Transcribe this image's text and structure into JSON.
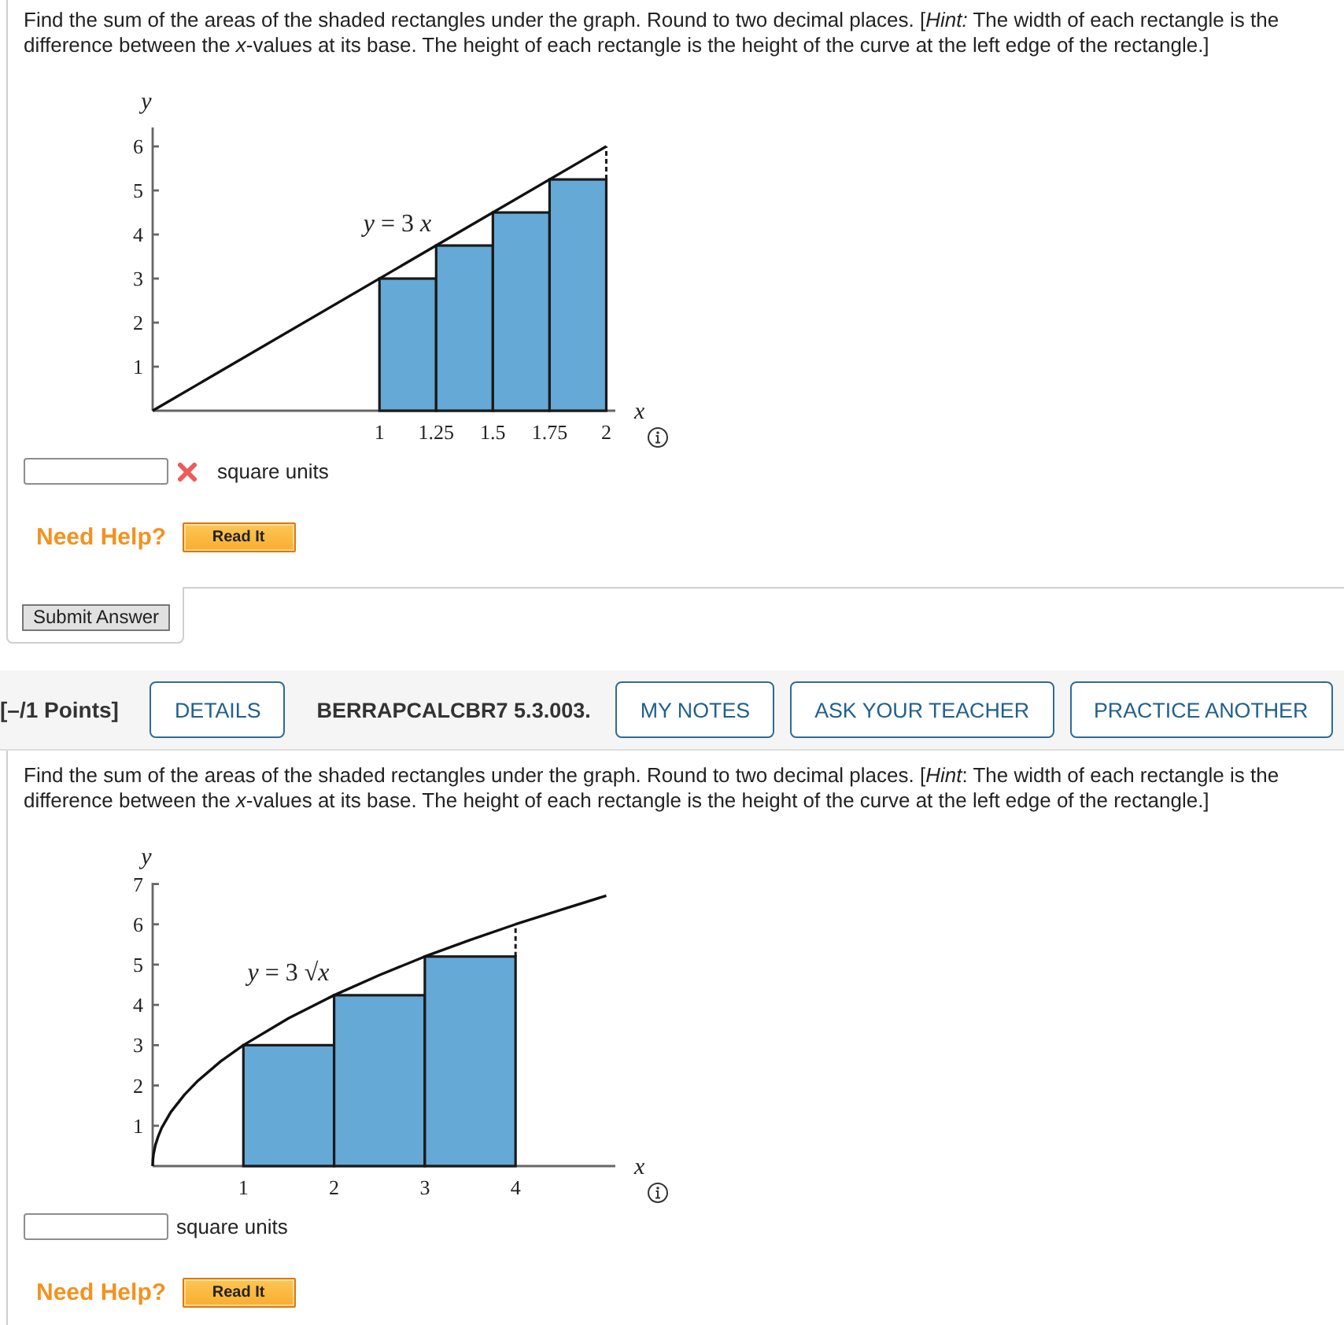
{
  "questions": [
    {
      "text": "Find the sum of the areas of the shaded rectangles under the graph. Round to two decimal places. [*Hint:* The width of each rectangle is the difference between the *x*-values at its base. The height of each rectangle is the height of the curve at the left edge of the rectangle.]",
      "figure": {
        "chart_data": {
          "type": "bar",
          "xlabel": "x",
          "ylabel": "y",
          "xlim": [
            0,
            2.04
          ],
          "ylim": [
            0,
            6.43
          ],
          "xticks": [
            1,
            1.25,
            1.5,
            1.75,
            2
          ],
          "yticks": [
            1,
            2,
            3,
            4,
            5,
            6
          ],
          "series": [
            {
              "color": "#65a9d6",
              "x": [
                1.125,
                1.375,
                1.625,
                1.875
              ],
              "values": [
                3,
                3.75,
                4.5,
                5.25
              ]
            },
            {
              "type": "line",
              "color": "#111111",
              "x": [
                0,
                1.25,
                2
              ],
              "values": [
                0,
                3.75,
                6
              ]
            }
          ],
          "annotations": [
            {
              "text": "*y* = 3 *x*",
              "x": 1.25,
              "y": 3.75
            }
          ]
        }
      },
      "answer": {
        "marked_incorrect": true,
        "unit": "square units"
      },
      "help": {
        "label": "Need Help?",
        "buttons": [
          "Read It"
        ]
      },
      "submit_button": "Submit Answer"
    },
    {
      "header": {
        "points": "[–/1 Points]",
        "items": [
          {
            "kind": "button",
            "text": "DETAILS"
          },
          {
            "kind": "code",
            "text": "BERRAPCALCBR7 5.3.003."
          },
          {
            "kind": "button",
            "text": "MY NOTES"
          },
          {
            "kind": "button",
            "text": "ASK YOUR TEACHER"
          },
          {
            "kind": "button",
            "text": "PRACTICE ANOTHER"
          }
        ]
      },
      "text": "Find the sum of the areas of the shaded rectangles under the graph. Round to two decimal places. [*Hint*: The width of each rectangle is the difference between the *x*-values at its base. The height of each rectangle is the height of the curve at the left edge of the rectangle.]",
      "figure": {
        "chart_data": {
          "type": "bar",
          "xlabel": "x",
          "ylabel": "y",
          "xlim": [
            0,
            5.1
          ],
          "ylim": [
            0,
            7.03
          ],
          "xticks": [
            1,
            2,
            3,
            4
          ],
          "yticks": [
            1,
            2,
            3,
            4,
            5,
            6,
            7
          ],
          "series": [
            {
              "color": "#65a9d6",
              "x": [
                1.5,
                2.5,
                3.5
              ],
              "values": [
                3,
                4.24,
                5.2
              ]
            },
            {
              "type": "line",
              "color": "#111111",
              "x": [
                0,
                0.003,
                0.01,
                0.03,
                0.06,
                0.1,
                0.2,
                0.35,
                0.5,
                0.75,
                1,
                1.5,
                2,
                2.5,
                3,
                3.5,
                4,
                4.5,
                5
              ],
              "values": [
                0,
                0.16,
                0.3,
                0.52,
                0.73,
                0.95,
                1.34,
                1.77,
                2.12,
                2.6,
                3,
                3.67,
                4.24,
                4.74,
                5.2,
                5.61,
                6,
                6.36,
                6.71
              ]
            }
          ],
          "annotations": [
            {
              "text": "*y* = 3 √*x*",
              "x": 2,
              "y": 4.24
            }
          ]
        }
      },
      "answer": {
        "marked_incorrect": false,
        "unit": "square units"
      },
      "help": {
        "label": "Need Help?",
        "buttons": [
          "Read It"
        ]
      }
    }
  ]
}
